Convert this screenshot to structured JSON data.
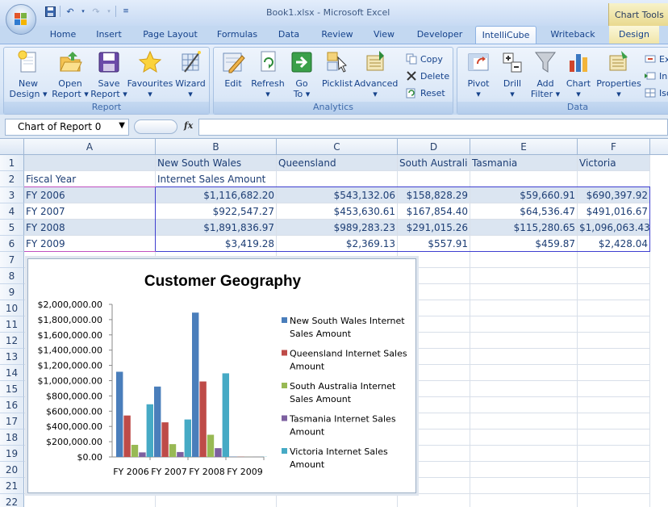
{
  "window": {
    "title": "Book1.xlsx - Microsoft Excel",
    "contextual_tab_group": "Chart Tools"
  },
  "tabs": [
    {
      "label": "Home"
    },
    {
      "label": "Insert"
    },
    {
      "label": "Page Layout"
    },
    {
      "label": "Formulas"
    },
    {
      "label": "Data"
    },
    {
      "label": "Review"
    },
    {
      "label": "View"
    },
    {
      "label": "Developer"
    },
    {
      "label": "IntelliCube",
      "active": true
    },
    {
      "label": "Writeback"
    },
    {
      "label": "Design"
    }
  ],
  "ribbon": {
    "report_group": {
      "label": "Report",
      "buttons": [
        {
          "line1": "New",
          "line2": "Design ▾",
          "icon": "new-design-icon"
        },
        {
          "line1": "Open",
          "line2": "Report ▾",
          "icon": "open-report-icon"
        },
        {
          "line1": "Save",
          "line2": "Report ▾",
          "icon": "save-report-icon"
        },
        {
          "line1": "Favourites",
          "line2": "▾",
          "icon": "star-icon"
        },
        {
          "line1": "Wizard",
          "line2": "▾",
          "icon": "wizard-icon"
        }
      ]
    },
    "analytics_group": {
      "label": "Analytics",
      "buttons": [
        {
          "line1": "Edit",
          "line2": "",
          "icon": "edit-icon"
        },
        {
          "line1": "Refresh",
          "line2": "▾",
          "icon": "refresh-icon"
        },
        {
          "line1": "Go",
          "line2": "To ▾",
          "icon": "goto-icon"
        },
        {
          "line1": "Picklist",
          "line2": "",
          "icon": "picklist-icon"
        },
        {
          "line1": "Advanced",
          "line2": "▾",
          "icon": "advanced-icon"
        }
      ],
      "small_buttons": [
        {
          "label": "Copy",
          "icon": "copy-icon"
        },
        {
          "label": "Delete",
          "icon": "delete-icon"
        },
        {
          "label": "Reset",
          "icon": "reset-icon"
        }
      ]
    },
    "data_group": {
      "label": "Data",
      "buttons": [
        {
          "line1": "Pivot",
          "line2": "▾",
          "icon": "pivot-icon"
        },
        {
          "line1": "Drill",
          "line2": "▾",
          "icon": "drill-icon"
        },
        {
          "line1": "Add",
          "line2": "Filter ▾",
          "icon": "filter-icon"
        },
        {
          "line1": "Chart",
          "line2": "▾",
          "icon": "chart-icon"
        },
        {
          "line1": "Properties",
          "line2": "▾",
          "icon": "properties-icon"
        }
      ],
      "small_buttons": [
        {
          "label": "Ex",
          "icon": "expand-icon"
        },
        {
          "label": "In",
          "icon": "insert-icon"
        },
        {
          "label": "Iso",
          "icon": "isolate-icon"
        }
      ]
    }
  },
  "formula_bar": {
    "name_box": "Chart of Report 0",
    "fx": "fx",
    "formula": ""
  },
  "grid": {
    "columns": [
      "A",
      "B",
      "C",
      "D",
      "E",
      "F"
    ],
    "row_numbers": [
      "1",
      "2",
      "3",
      "4",
      "5",
      "6",
      "7",
      "8",
      "9",
      "10",
      "11",
      "12",
      "13",
      "14",
      "15",
      "16",
      "17",
      "18",
      "19",
      "20",
      "21",
      "22"
    ],
    "header_row": [
      "",
      "New South Wales",
      "Queensland",
      "South Australi",
      "Tasmania",
      "Victoria"
    ],
    "measure_row": [
      "Fiscal Year",
      "Internet Sales Amount",
      "",
      "",
      "",
      ""
    ],
    "data_rows": [
      [
        "FY 2006",
        "$1,116,682.20",
        "$543,132.06",
        "$158,828.29",
        "$59,660.91",
        "$690,397.92"
      ],
      [
        "FY 2007",
        "$922,547.27",
        "$453,630.61",
        "$167,854.40",
        "$64,536.47",
        "$491,016.67"
      ],
      [
        "FY 2008",
        "$1,891,836.97",
        "$989,283.23",
        "$291,015.26",
        "$115,280.65",
        "$1,096,063.43"
      ],
      [
        "FY 2009",
        "$3,419.28",
        "$2,369.13",
        "$557.91",
        "$459.87",
        "$2,428.04"
      ]
    ]
  },
  "chart_data": {
    "type": "bar",
    "title": "Customer Geography",
    "categories": [
      "FY 2006",
      "FY 2007",
      "FY 2008",
      "FY 2009"
    ],
    "series": [
      {
        "name": "New South Wales Internet Sales Amount",
        "color": "#4a7ebb",
        "values": [
          1116682.2,
          922547.27,
          1891836.97,
          3419.28
        ]
      },
      {
        "name": "Queensland Internet Sales Amount",
        "color": "#be4b48",
        "values": [
          543132.06,
          453630.61,
          989283.23,
          2369.13
        ]
      },
      {
        "name": "South Australia Internet Sales Amount",
        "color": "#98b954",
        "values": [
          158828.29,
          167854.4,
          291015.26,
          557.91
        ]
      },
      {
        "name": "Tasmania Internet Sales Amount",
        "color": "#7d60a0",
        "values": [
          59660.91,
          64536.47,
          115280.65,
          459.87
        ]
      },
      {
        "name": "Victoria Internet Sales Amount",
        "color": "#46aac5",
        "values": [
          690397.92,
          491016.67,
          1096063.43,
          2428.04
        ]
      }
    ],
    "ylim": [
      0,
      2000000
    ],
    "yticks": [
      "$0.00",
      "$200,000.00",
      "$400,000.00",
      "$600,000.00",
      "$800,000.00",
      "$1,000,000.00",
      "$1,200,000.00",
      "$1,400,000.00",
      "$1,600,000.00",
      "$1,800,000.00",
      "$2,000,000.00"
    ],
    "legend_lines": [
      [
        "New South Wales Internet",
        "Sales Amount"
      ],
      [
        "Queensland Internet Sales",
        "Amount"
      ],
      [
        "South Australia Internet",
        "Sales Amount"
      ],
      [
        "Tasmania Internet Sales",
        "Amount"
      ],
      [
        "Victoria Internet Sales",
        "Amount"
      ]
    ],
    "legend_position": "right",
    "grid": false
  }
}
